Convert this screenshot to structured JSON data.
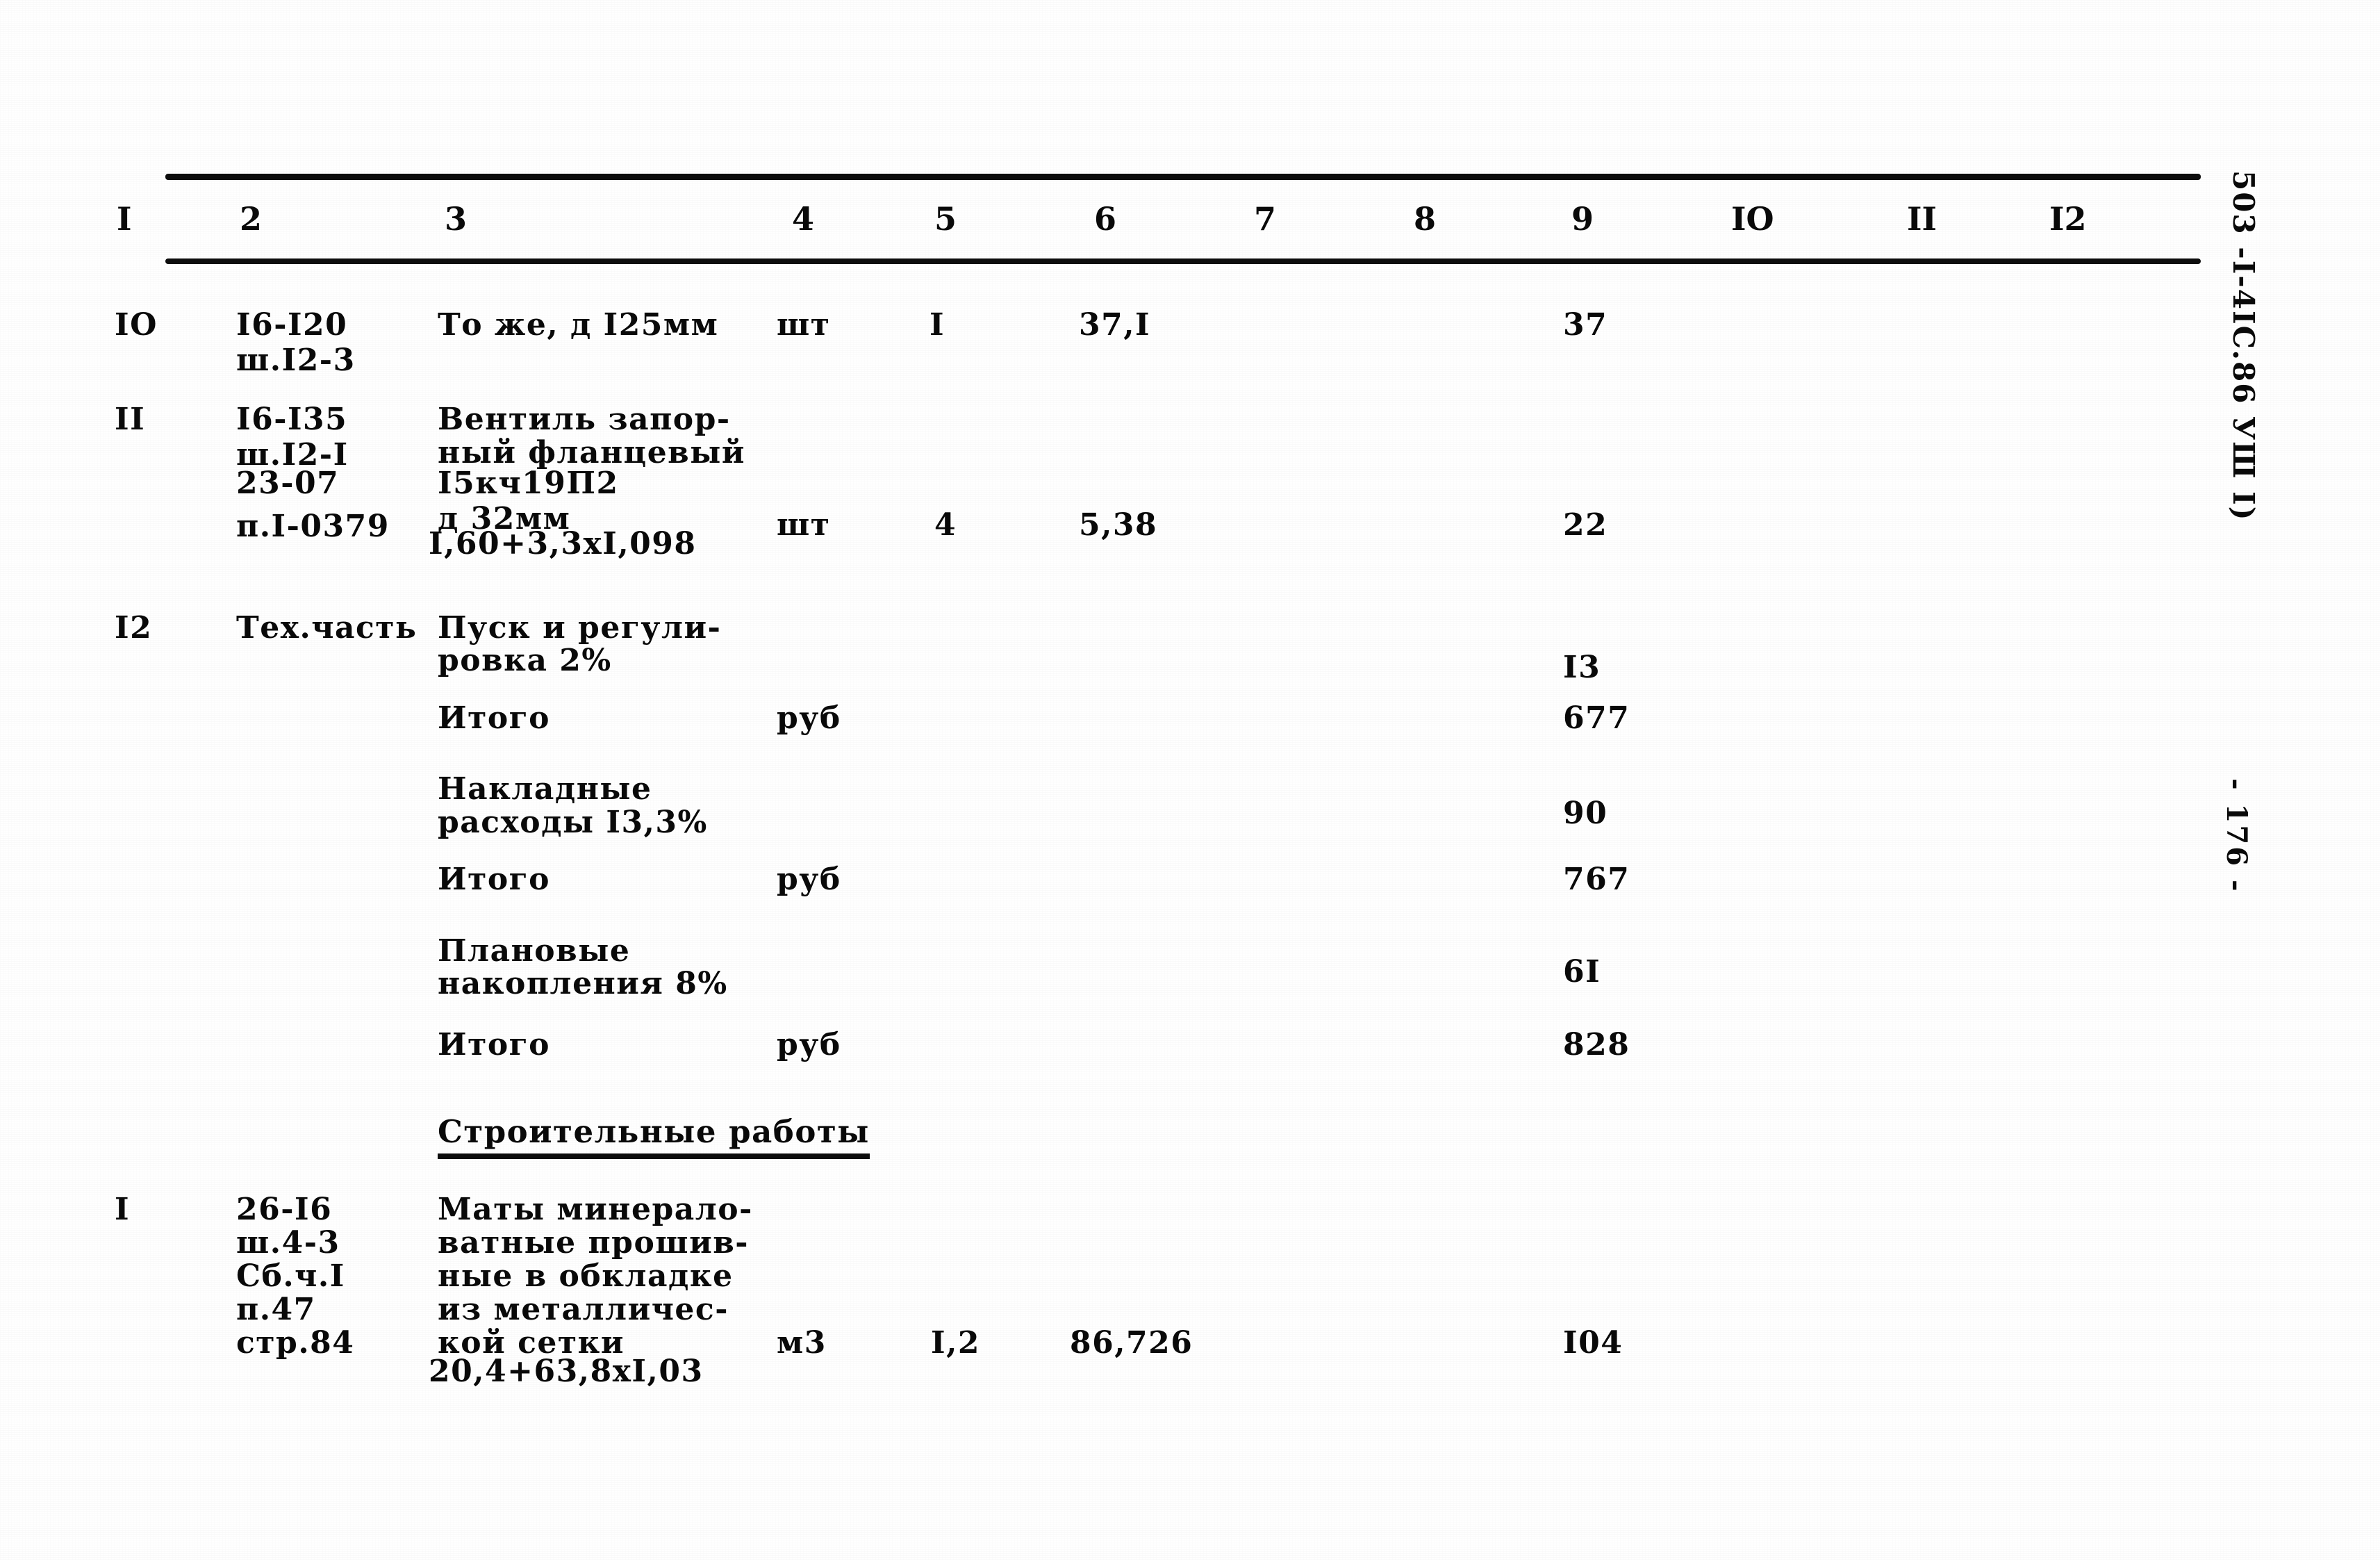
{
  "document": {
    "margin_code": "503 -I-4IC.86 УШ I)",
    "page_marker": "- 176 -"
  },
  "table": {
    "column_headers": [
      "I",
      "2",
      "3",
      "4",
      "5",
      "6",
      "7",
      "8",
      "9",
      "IO",
      "II",
      "I2"
    ],
    "rows": [
      {
        "num": "IO",
        "code_lines": [
          "I6-I20",
          "ш.I2-3"
        ],
        "desc_lines": [
          "То же, д I25мм"
        ],
        "unit": "шт",
        "qty": "I",
        "price": "37,I",
        "col7": "",
        "col8": "",
        "total": "37",
        "col10": "",
        "col11": "",
        "col12": ""
      },
      {
        "num": "II",
        "code_lines": [
          "I6-I35",
          "ш.I2-I",
          "23-07",
          "п.I-0379"
        ],
        "desc_lines": [
          "Вентиль запор-",
          "ный фланцевый",
          "I5кч19П2",
          "д 32мм",
          "I,60+3,3xI,098"
        ],
        "unit": "шт",
        "qty": "4",
        "price": "5,38",
        "col7": "",
        "col8": "",
        "total": "22",
        "col10": "",
        "col11": "",
        "col12": ""
      },
      {
        "num": "I2",
        "code_lines": [
          "Тех.часть"
        ],
        "desc_lines": [
          "Пуск и регули-",
          "ровка 2%"
        ],
        "unit": "",
        "qty": "",
        "price": "",
        "col7": "",
        "col8": "",
        "total": "I3",
        "col10": "",
        "col11": "",
        "col12": ""
      }
    ],
    "summary_rows": [
      {
        "label_lines": [
          "Итого"
        ],
        "unit": "руб",
        "total": "677"
      },
      {
        "label_lines": [
          "Накладные",
          "расходы I3,3%"
        ],
        "unit": "",
        "total": "90"
      },
      {
        "label_lines": [
          "Итого"
        ],
        "unit": "руб",
        "total": "767"
      },
      {
        "label_lines": [
          "Плановые",
          "накопления 8%"
        ],
        "unit": "",
        "total": "6I"
      },
      {
        "label_lines": [
          "Итого"
        ],
        "unit": "руб",
        "total": "828"
      }
    ],
    "section_heading": "Строительные работы",
    "section_rows": [
      {
        "num": "I",
        "code_lines": [
          "26-I6",
          "ш.4-3",
          "Сб.ч.I",
          "п.47",
          "стр.84"
        ],
        "desc_lines": [
          "Маты минерало-",
          "ватные прошив-",
          "ные в обкладке",
          "из металличес-",
          "кой сетки",
          "20,4+63,8xI,03"
        ],
        "unit": "м3",
        "qty": "I,2",
        "price": "86,726",
        "col7": "",
        "col8": "",
        "total": "I04",
        "col10": "",
        "col11": "",
        "col12": ""
      }
    ]
  }
}
